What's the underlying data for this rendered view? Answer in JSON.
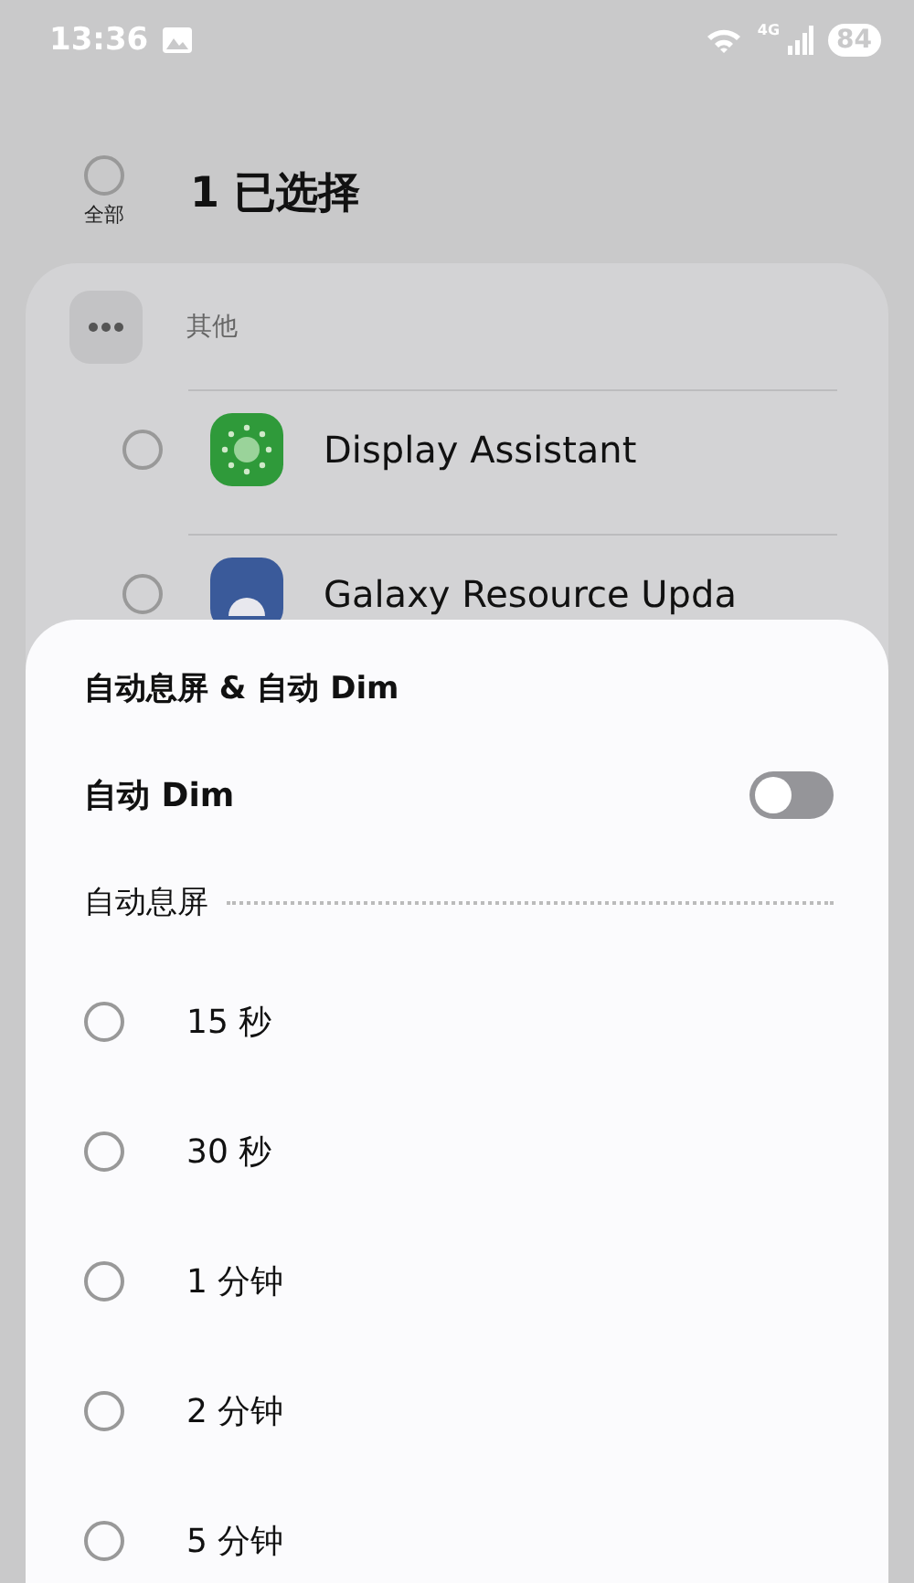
{
  "status_bar": {
    "time": "13:36",
    "network": "4G",
    "battery": "84"
  },
  "header": {
    "select_all": {
      "label": "全部",
      "checked": false
    },
    "title": "1 已选择"
  },
  "group": {
    "title": "其他",
    "apps": [
      {
        "name": "Display Assistant",
        "checked": false,
        "kind": "display"
      },
      {
        "name": "Galaxy Resource Upda",
        "checked": false,
        "kind": "android"
      }
    ]
  },
  "sheet": {
    "title": "自动息屏 & 自动 Dim",
    "toggle": {
      "label": "自动 Dim",
      "on": false
    },
    "section": "自动息屏",
    "options": [
      {
        "label": "15 秒",
        "selected": false
      },
      {
        "label": "30 秒",
        "selected": false
      },
      {
        "label": "1 分钟",
        "selected": false
      },
      {
        "label": "2 分钟",
        "selected": false
      },
      {
        "label": "5 分钟",
        "selected": false
      }
    ]
  }
}
